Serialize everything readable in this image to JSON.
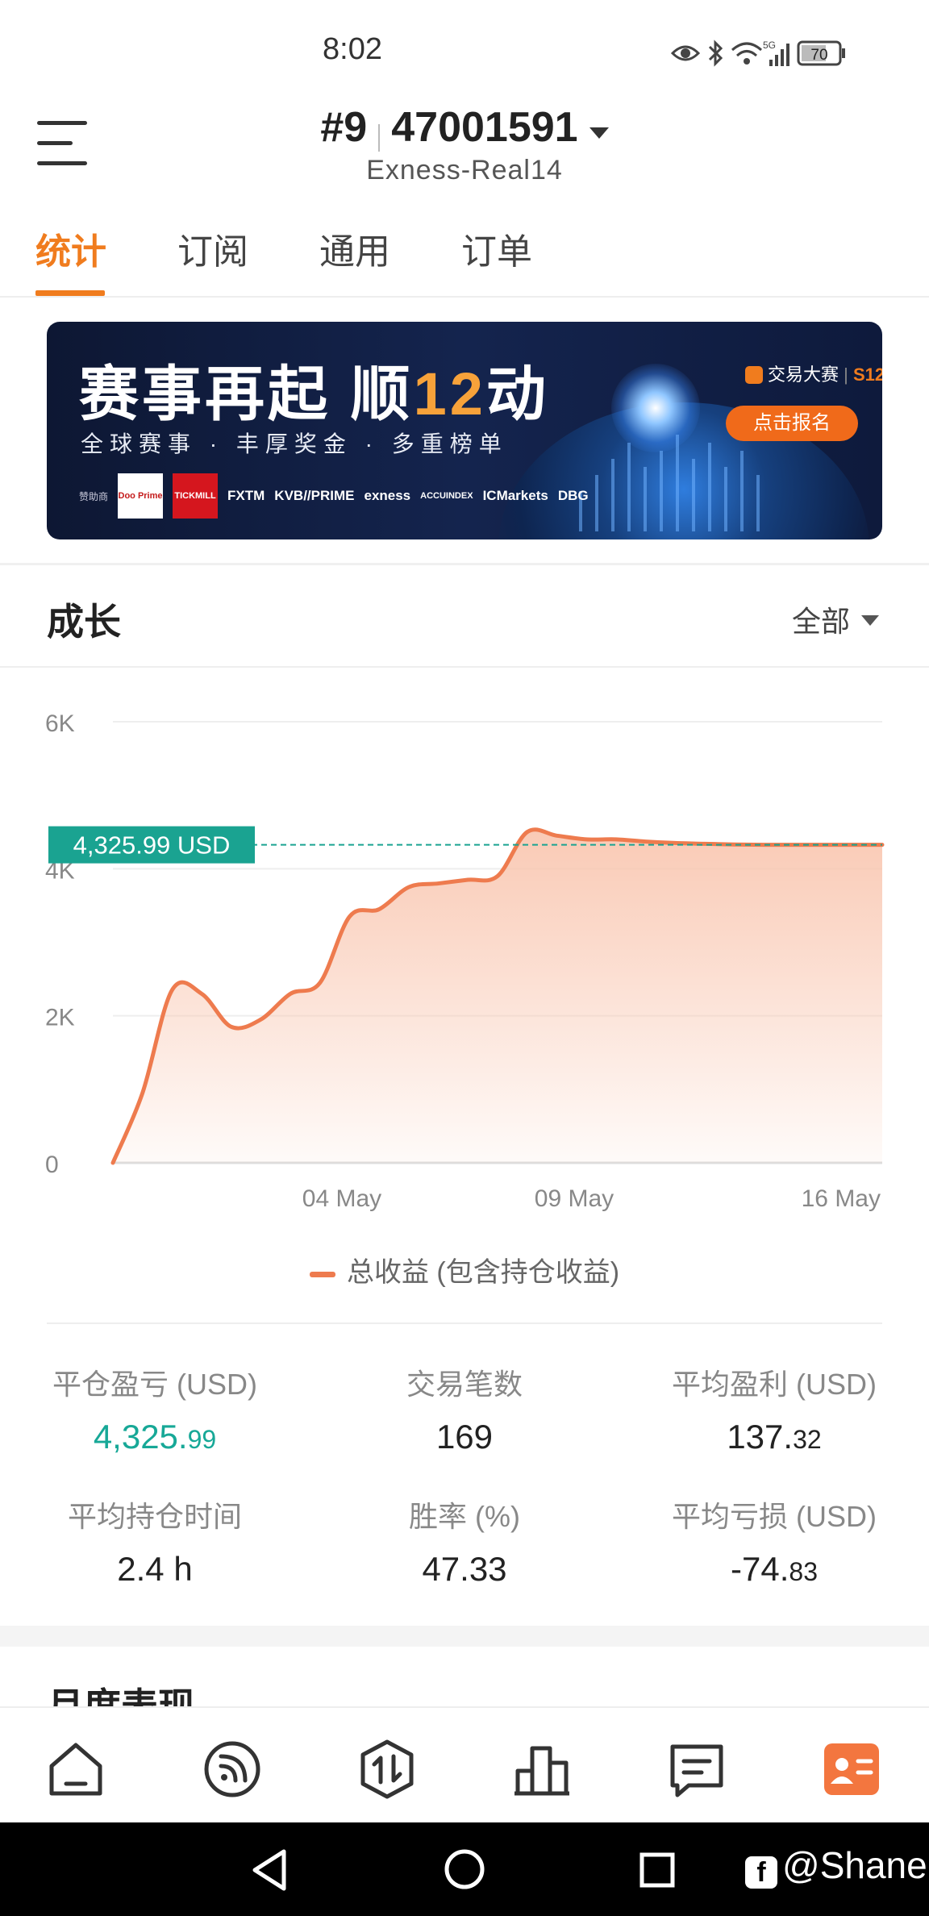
{
  "status_bar": {
    "time": "8:02",
    "battery": "70",
    "network": "5G",
    "icons": [
      "eye-icon",
      "bluetooth-icon",
      "wifi-icon",
      "signal-icon",
      "battery-icon"
    ]
  },
  "header": {
    "rank": "#9",
    "account_number": "47001591",
    "server": "Exness-Real14"
  },
  "tabs": [
    {
      "label": "统计",
      "active": true
    },
    {
      "label": "订阅",
      "active": false
    },
    {
      "label": "通用",
      "active": false
    },
    {
      "label": "订单",
      "active": false
    }
  ],
  "banner": {
    "title_part1": "赛事再起 顺",
    "title_highlight": "12",
    "title_part2": "动",
    "subtitle": "全球赛事 · 丰厚奖金 · 多重榜单",
    "brand": "交易大赛",
    "brand_season": "S12",
    "cta": "点击报名",
    "sponsor_label": "赞助商",
    "sponsors": [
      "Doo Prime",
      "TICKMILL",
      "FXTM",
      "KVB//PRIME",
      "exness",
      "ACCUINDEX",
      "ICMarkets",
      "DBG"
    ]
  },
  "growth": {
    "title": "成长",
    "filter": "全部",
    "legend": "总收益 (包含持仓收益)",
    "current_label": "4,325.99 USD"
  },
  "chart_data": {
    "type": "area",
    "x_tick_labels": [
      "04 May",
      "09 May",
      "16 May"
    ],
    "y_tick_labels": [
      "0",
      "2K",
      "4K",
      "6K"
    ],
    "ylim": [
      0,
      6000
    ],
    "x": [
      0,
      1,
      2,
      3,
      4,
      5,
      6,
      7,
      8,
      9,
      10,
      11,
      12,
      13,
      14,
      15,
      16,
      17,
      18,
      19,
      20,
      21,
      22,
      23,
      24,
      25,
      26
    ],
    "series": [
      {
        "name": "总收益 (包含持仓收益)",
        "values": [
          0,
          950,
          2350,
          2300,
          1850,
          1950,
          2300,
          2450,
          3350,
          3450,
          3750,
          3800,
          3850,
          3900,
          4500,
          4450,
          4400,
          4400,
          4370,
          4350,
          4340,
          4330,
          4326,
          4326,
          4326,
          4326,
          4326
        ]
      }
    ],
    "reference_line": 4325.99,
    "colors": {
      "line": "#ee7b4e",
      "fill_top": "#f9c7b1",
      "reference": "#1aa391"
    },
    "grid": true
  },
  "stats": [
    {
      "label": "平仓盈亏 (USD)",
      "value_main": "4,325.",
      "value_frac": "99",
      "color": "green"
    },
    {
      "label": "交易笔数",
      "value_main": "169",
      "value_frac": ""
    },
    {
      "label": "平均盈利 (USD)",
      "value_main": "137.",
      "value_frac": "32"
    },
    {
      "label": "平均持仓时间",
      "value_main": "2.4 h",
      "value_frac": ""
    },
    {
      "label": "胜率 (%)",
      "value_main": "47.33",
      "value_frac": ""
    },
    {
      "label": "平均亏损 (USD)",
      "value_main": "-74.",
      "value_frac": "83"
    }
  ],
  "monthly": {
    "title": "月度表现"
  },
  "bottom_nav": [
    {
      "name": "home-icon",
      "active": false
    },
    {
      "name": "signal-feed-icon",
      "active": false
    },
    {
      "name": "trade-icon",
      "active": false
    },
    {
      "name": "ranking-icon",
      "active": false
    },
    {
      "name": "message-icon",
      "active": false
    },
    {
      "name": "profile-card-icon",
      "active": true
    }
  ],
  "watermark": {
    "handle": "@Shanel",
    "logo": "f"
  }
}
